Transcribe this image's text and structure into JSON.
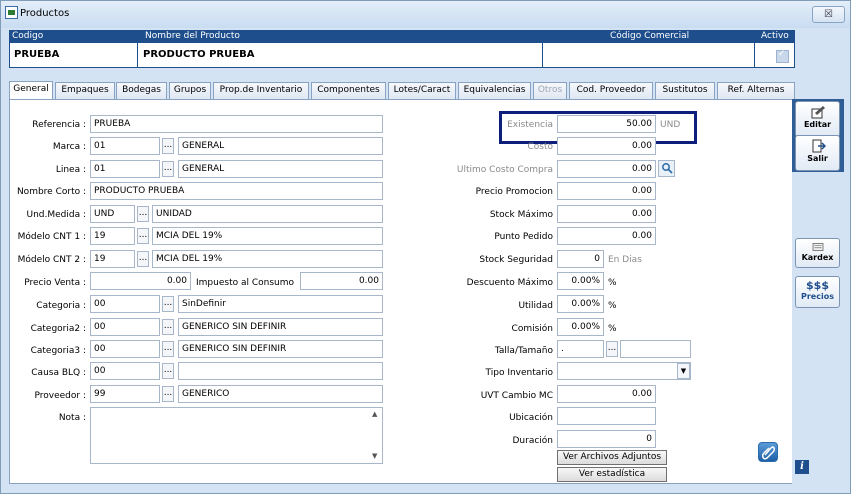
{
  "window": {
    "title": "Productos",
    "close_glyph": "☒"
  },
  "header": {
    "col_codigo": "Codigo",
    "col_nombre": "Nombre del Producto",
    "col_comercial": "Código Comercial",
    "col_activo": "Activo",
    "codigo": "PRUEBA",
    "nombre": "PRODUCTO PRUEBA",
    "comercial": "",
    "activo": true
  },
  "tabs": [
    {
      "label": "General",
      "active": true
    },
    {
      "label": "Empaques"
    },
    {
      "label": "Bodegas"
    },
    {
      "label": "Grupos"
    },
    {
      "label": "Prop.de Inventario"
    },
    {
      "label": "Componentes"
    },
    {
      "label": "Lotes/Caract"
    },
    {
      "label": "Equivalencias"
    },
    {
      "label": "Otros",
      "disabled": true
    },
    {
      "label": "Cod. Proveedor"
    },
    {
      "label": "Sustitutos"
    },
    {
      "label": "Ref. Alternas"
    }
  ],
  "left": {
    "referencia": {
      "label": "Referencia :",
      "value": "PRUEBA"
    },
    "marca": {
      "label": "Marca :",
      "code": "01",
      "desc": "GENERAL"
    },
    "linea": {
      "label": "Linea :",
      "code": "01",
      "desc": "GENERAL"
    },
    "nombre_corto": {
      "label": "Nombre Corto :",
      "value": "PRODUCTO PRUEBA"
    },
    "und_medida": {
      "label": "Und.Medida :",
      "code": "UND",
      "desc": "UNIDAD"
    },
    "modelo1": {
      "label": "Módelo CNT 1 :",
      "code": "19",
      "desc": "MCIA DEL 19%"
    },
    "modelo2": {
      "label": "Módelo CNT 2 :",
      "code": "19",
      "desc": "MCIA DEL 19%"
    },
    "precio_venta": {
      "label": "Precio Venta :",
      "value": "0.00"
    },
    "impuesto": {
      "label": "Impuesto al Consumo",
      "value": "0.00"
    },
    "categoria": {
      "label": "Categoria :",
      "code": "00",
      "desc": "SinDefinir"
    },
    "categoria2": {
      "label": "Categoria2 :",
      "code": "00",
      "desc": "GENERICO SIN DEFINIR"
    },
    "categoria3": {
      "label": "Categoria3 :",
      "code": "00",
      "desc": "GENERICO SIN DEFINIR"
    },
    "causa_blq": {
      "label": "Causa BLQ :",
      "code": "00",
      "desc": ""
    },
    "proveedor": {
      "label": "Proveedor :",
      "code": "99",
      "desc": "GENERICO"
    },
    "nota": {
      "label": "Nota :",
      "value": ""
    }
  },
  "right": {
    "existencia": {
      "label": "Existencia",
      "value": "50.00",
      "unit": "UND"
    },
    "costo": {
      "label": "Costo",
      "value": "0.00"
    },
    "ultimo_costo": {
      "label": "Ultimo Costo Compra",
      "value": "0.00"
    },
    "precio_promocion": {
      "label": "Precio Promocion",
      "value": "0.00"
    },
    "stock_maximo": {
      "label": "Stock Máximo",
      "value": "0.00"
    },
    "punto_pedido": {
      "label": "Punto Pedido",
      "value": "0.00"
    },
    "stock_seguridad": {
      "label": "Stock Seguridad",
      "value": "0",
      "unit": "En Dias"
    },
    "descuento_maximo": {
      "label": "Descuento Máximo",
      "value": "0.00%",
      "pct": "%"
    },
    "utilidad": {
      "label": "Utilidad",
      "value": "0.00%",
      "pct": "%"
    },
    "comision": {
      "label": "Comisión",
      "value": "0.00%",
      "pct": "%"
    },
    "talla": {
      "label": "Talla/Tamaño",
      "value": "."
    },
    "tipo_inventario": {
      "label": "Tipo Inventario",
      "value": ""
    },
    "uvt": {
      "label": "UVT Cambio MC",
      "value": "0.00"
    },
    "ubicacion": {
      "label": "Ubicación",
      "value": ""
    },
    "duracion": {
      "label": "Duración",
      "value": "0"
    },
    "btn_adjuntos": "Ver Archivos Adjuntos",
    "btn_estadistica": "Ver estadística"
  },
  "sidebar": {
    "editar": "Editar",
    "salir": "Salir",
    "kardex": "Kardex",
    "precios_top": "$$$",
    "precios": "Precios"
  },
  "colors": {
    "accent": "#1f4e8c",
    "highlight": "#0d1f7a"
  }
}
